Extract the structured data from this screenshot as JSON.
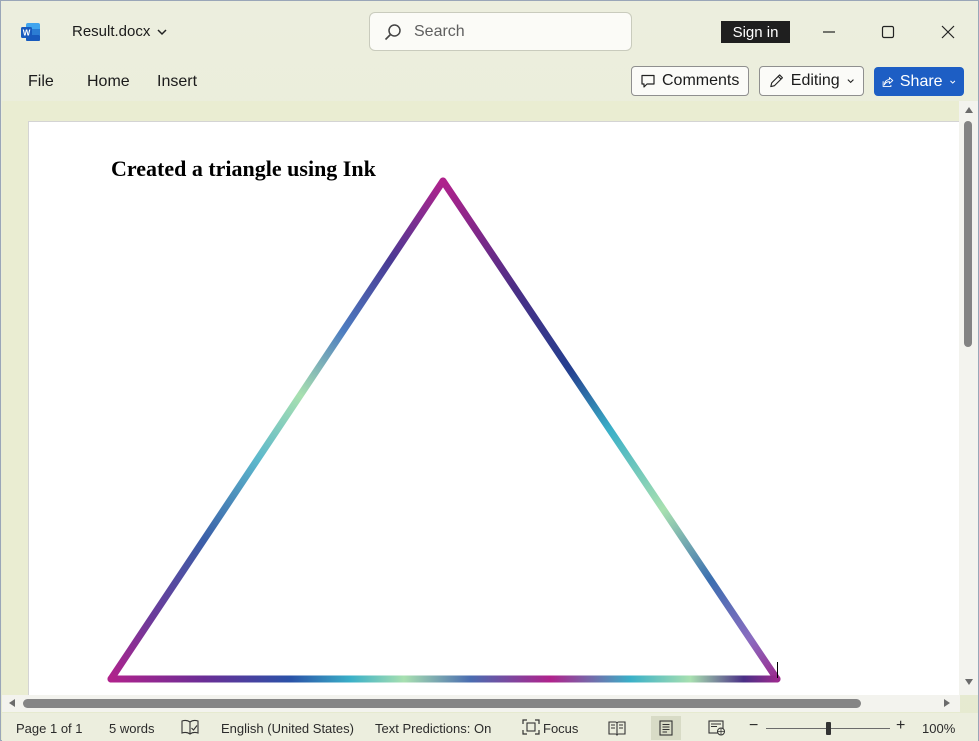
{
  "titlebar": {
    "file_name": "Result.docx",
    "search_placeholder": "Search",
    "sign_in": "Sign in"
  },
  "menu": {
    "file": "File",
    "home": "Home",
    "insert": "Insert",
    "comments": "Comments",
    "editing": "Editing",
    "share": "Share"
  },
  "document": {
    "heading": "Created a triangle using Ink"
  },
  "status": {
    "page": "Page 1 of 1",
    "words": "5 words",
    "language": "English (United States)",
    "text_predictions": "Text Predictions: On",
    "focus": "Focus",
    "zoom": "100%",
    "zoom_level": 100
  },
  "colors": {
    "share_blue": "#1d5ec4",
    "ink_magenta": "#b0228c",
    "ink_navy": "#243f8f",
    "ink_cyan": "#3ab0c8",
    "ink_mint": "#a8e0b0"
  }
}
